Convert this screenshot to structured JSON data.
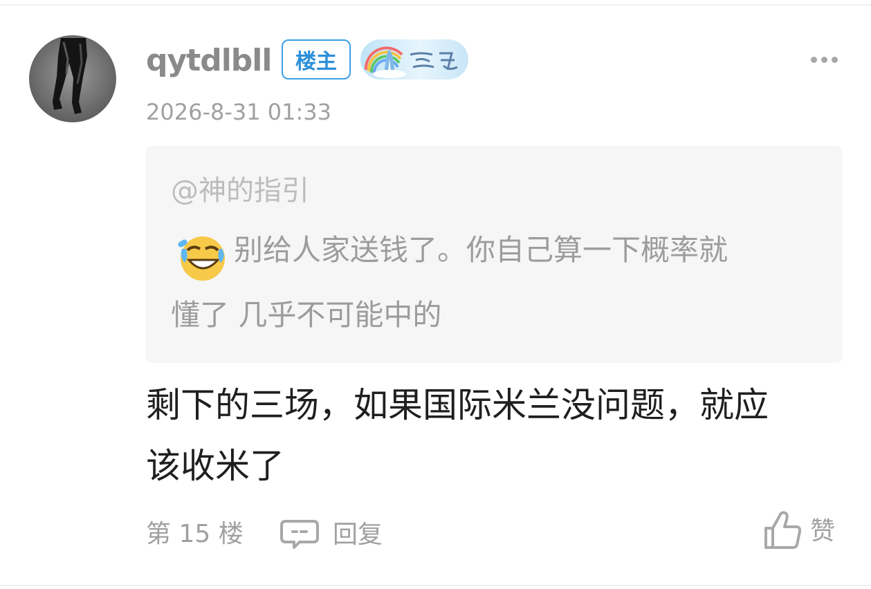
{
  "post": {
    "username": "qytdlbll",
    "op_badge": "楼主",
    "level_badge_icon": "rainbow-castle-level-badge",
    "timestamp": "2026-8-31 01:33",
    "quote": {
      "mention": "@神的指引",
      "emoji": "crying-laughing-emoji",
      "line1": "别给人家送钱了。你自己算一下概率就",
      "line2": "懂了 几乎不可能中的"
    },
    "content": {
      "line1": "剩下的三场，如果国际米兰没问题，就应",
      "line2": "该收米了"
    },
    "footer": {
      "floor": "第 15 楼",
      "reply_label": "回复",
      "like_label": "赞"
    }
  },
  "colors": {
    "op_badge_blue": "#2d8fd9",
    "muted_text": "#a0a0a0",
    "quote_background": "#f6f6f6",
    "content_text": "#1f1f1f"
  }
}
